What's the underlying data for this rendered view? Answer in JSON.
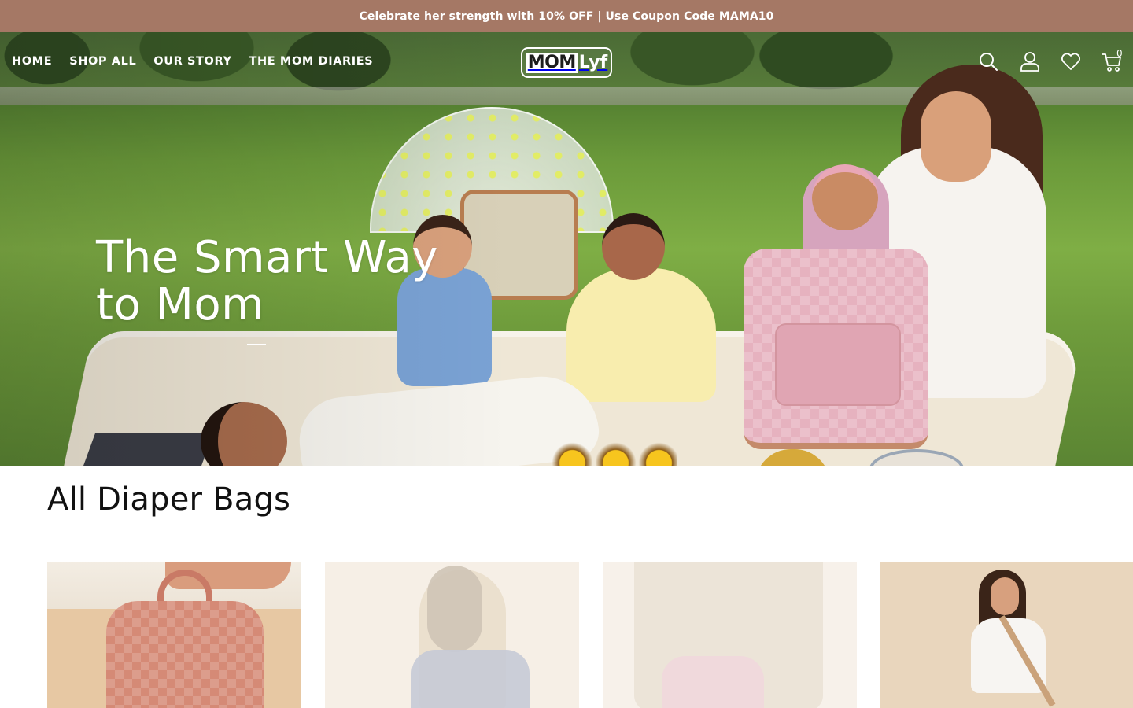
{
  "announcement": {
    "text": "Celebrate her strength with 10% OFF | Use Coupon Code MAMA10"
  },
  "header": {
    "nav": [
      {
        "label": "HOME"
      },
      {
        "label": "SHOP ALL"
      },
      {
        "label": "OUR STORY"
      },
      {
        "label": "THE MOM DIARIES"
      }
    ],
    "logo": {
      "part1": "MOM",
      "part2": "Lyf"
    },
    "icons": [
      "search-icon",
      "account-icon",
      "wishlist-heart-icon",
      "cart-icon"
    ],
    "cart_count": "0"
  },
  "hero": {
    "title_line1": "The Smart Way",
    "title_line2": "to Mom"
  },
  "collection": {
    "title": "All Diaper Bags",
    "products": [
      {
        "image": "product-image-1"
      },
      {
        "image": "product-image-2"
      },
      {
        "image": "product-image-3"
      },
      {
        "image": "product-image-4"
      }
    ]
  },
  "colors": {
    "announcement_bg": "#a57865",
    "text_dark": "#111111",
    "nav_text": "#ffffff"
  }
}
